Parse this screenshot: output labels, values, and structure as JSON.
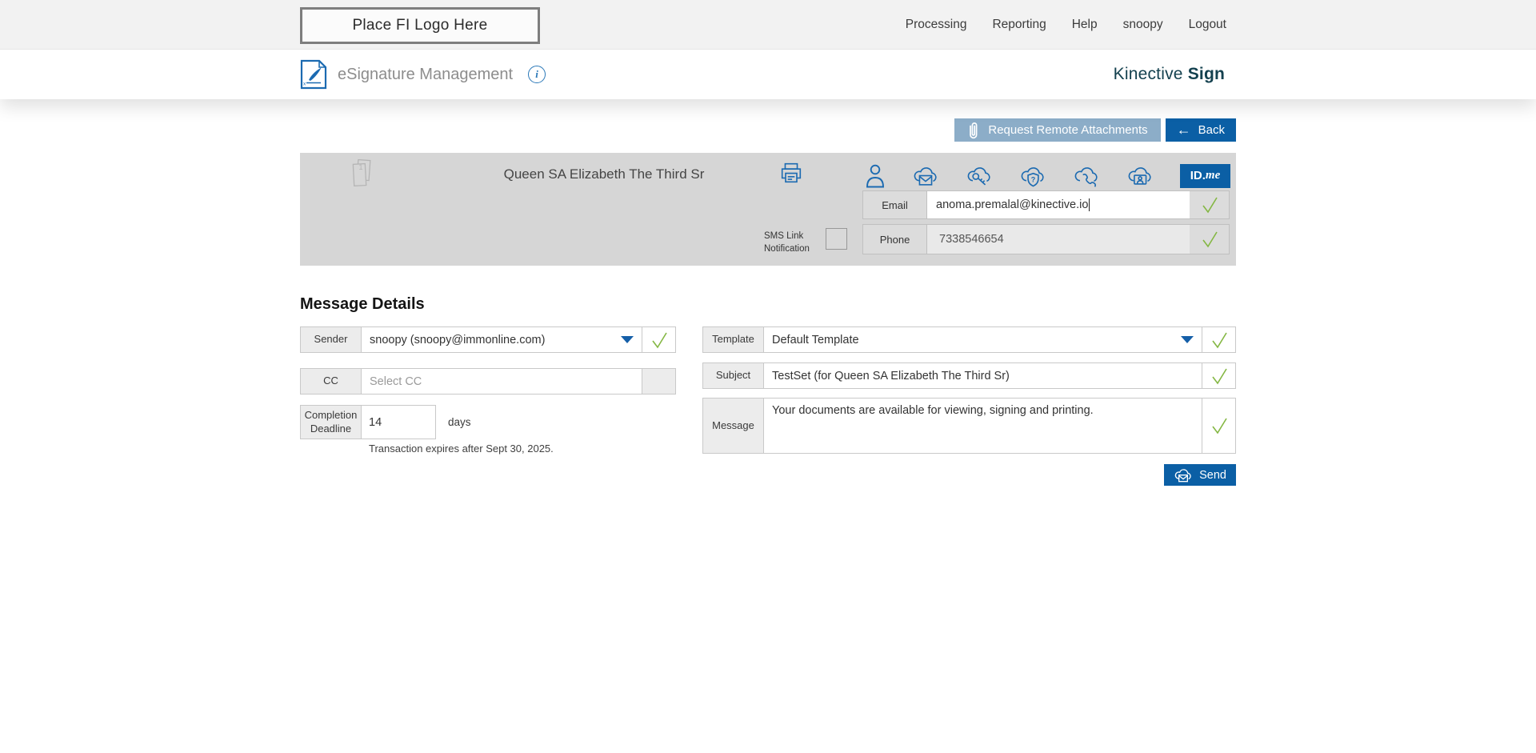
{
  "topbar": {
    "logo_placeholder": "Place FI Logo Here",
    "nav": [
      {
        "label": "Processing"
      },
      {
        "label": "Reporting"
      },
      {
        "label": "Help"
      },
      {
        "label": "snoopy"
      },
      {
        "label": "Logout"
      }
    ]
  },
  "header": {
    "title": "eSignature Management",
    "info_icon": "info-icon",
    "brand": {
      "regular": "Kinective ",
      "bold": "Sign"
    }
  },
  "toolbar": {
    "request_remote_attachments_label": "Request Remote Attachments",
    "back_label": "Back",
    "back_arrow": "←"
  },
  "recipient_panel": {
    "document_count": "1",
    "recipient_name": "Queen SA Elizabeth The Third Sr",
    "delivery_icons": [
      "person-icon",
      "cloud-email-icon",
      "cloud-key-icon",
      "cloud-shield-question-icon",
      "cloud-phone-icon",
      "cloud-id-verification-icon",
      "idme-badge"
    ],
    "idme": {
      "bold": "ID.",
      "italic": "me"
    },
    "email_row": {
      "label": "Email",
      "value": "anoma.premalal@kinective.io"
    },
    "sms_row": {
      "label": "SMS Link Notification",
      "checked": false
    },
    "phone_row": {
      "label": "Phone",
      "value": "7338546654"
    }
  },
  "message_details": {
    "heading": "Message Details",
    "sender": {
      "label": "Sender",
      "value": "snoopy (snoopy@immonline.com)"
    },
    "cc": {
      "label": "CC",
      "placeholder": "Select CC"
    },
    "completion_deadline": {
      "label": "Completion Deadline",
      "value": "14",
      "unit": "days",
      "note": "Transaction expires after Sept 30, 2025."
    },
    "template": {
      "label": "Template",
      "value": "Default Template"
    },
    "subject": {
      "label": "Subject",
      "value": "TestSet (for Queen SA Elizabeth The Third Sr)"
    },
    "message": {
      "label": "Message",
      "value": "Your documents are available for viewing, signing and printing."
    },
    "send_label": "Send"
  },
  "colors": {
    "accent_blue": "#0b5fa5",
    "icon_blue": "#1b6ab1",
    "light_blue_button": "#8cadc8",
    "check_green": "#84b743",
    "panel_gray": "#d6d6d6",
    "brand_teal": "#14414f",
    "topbar_gray": "#f2f2f2"
  }
}
